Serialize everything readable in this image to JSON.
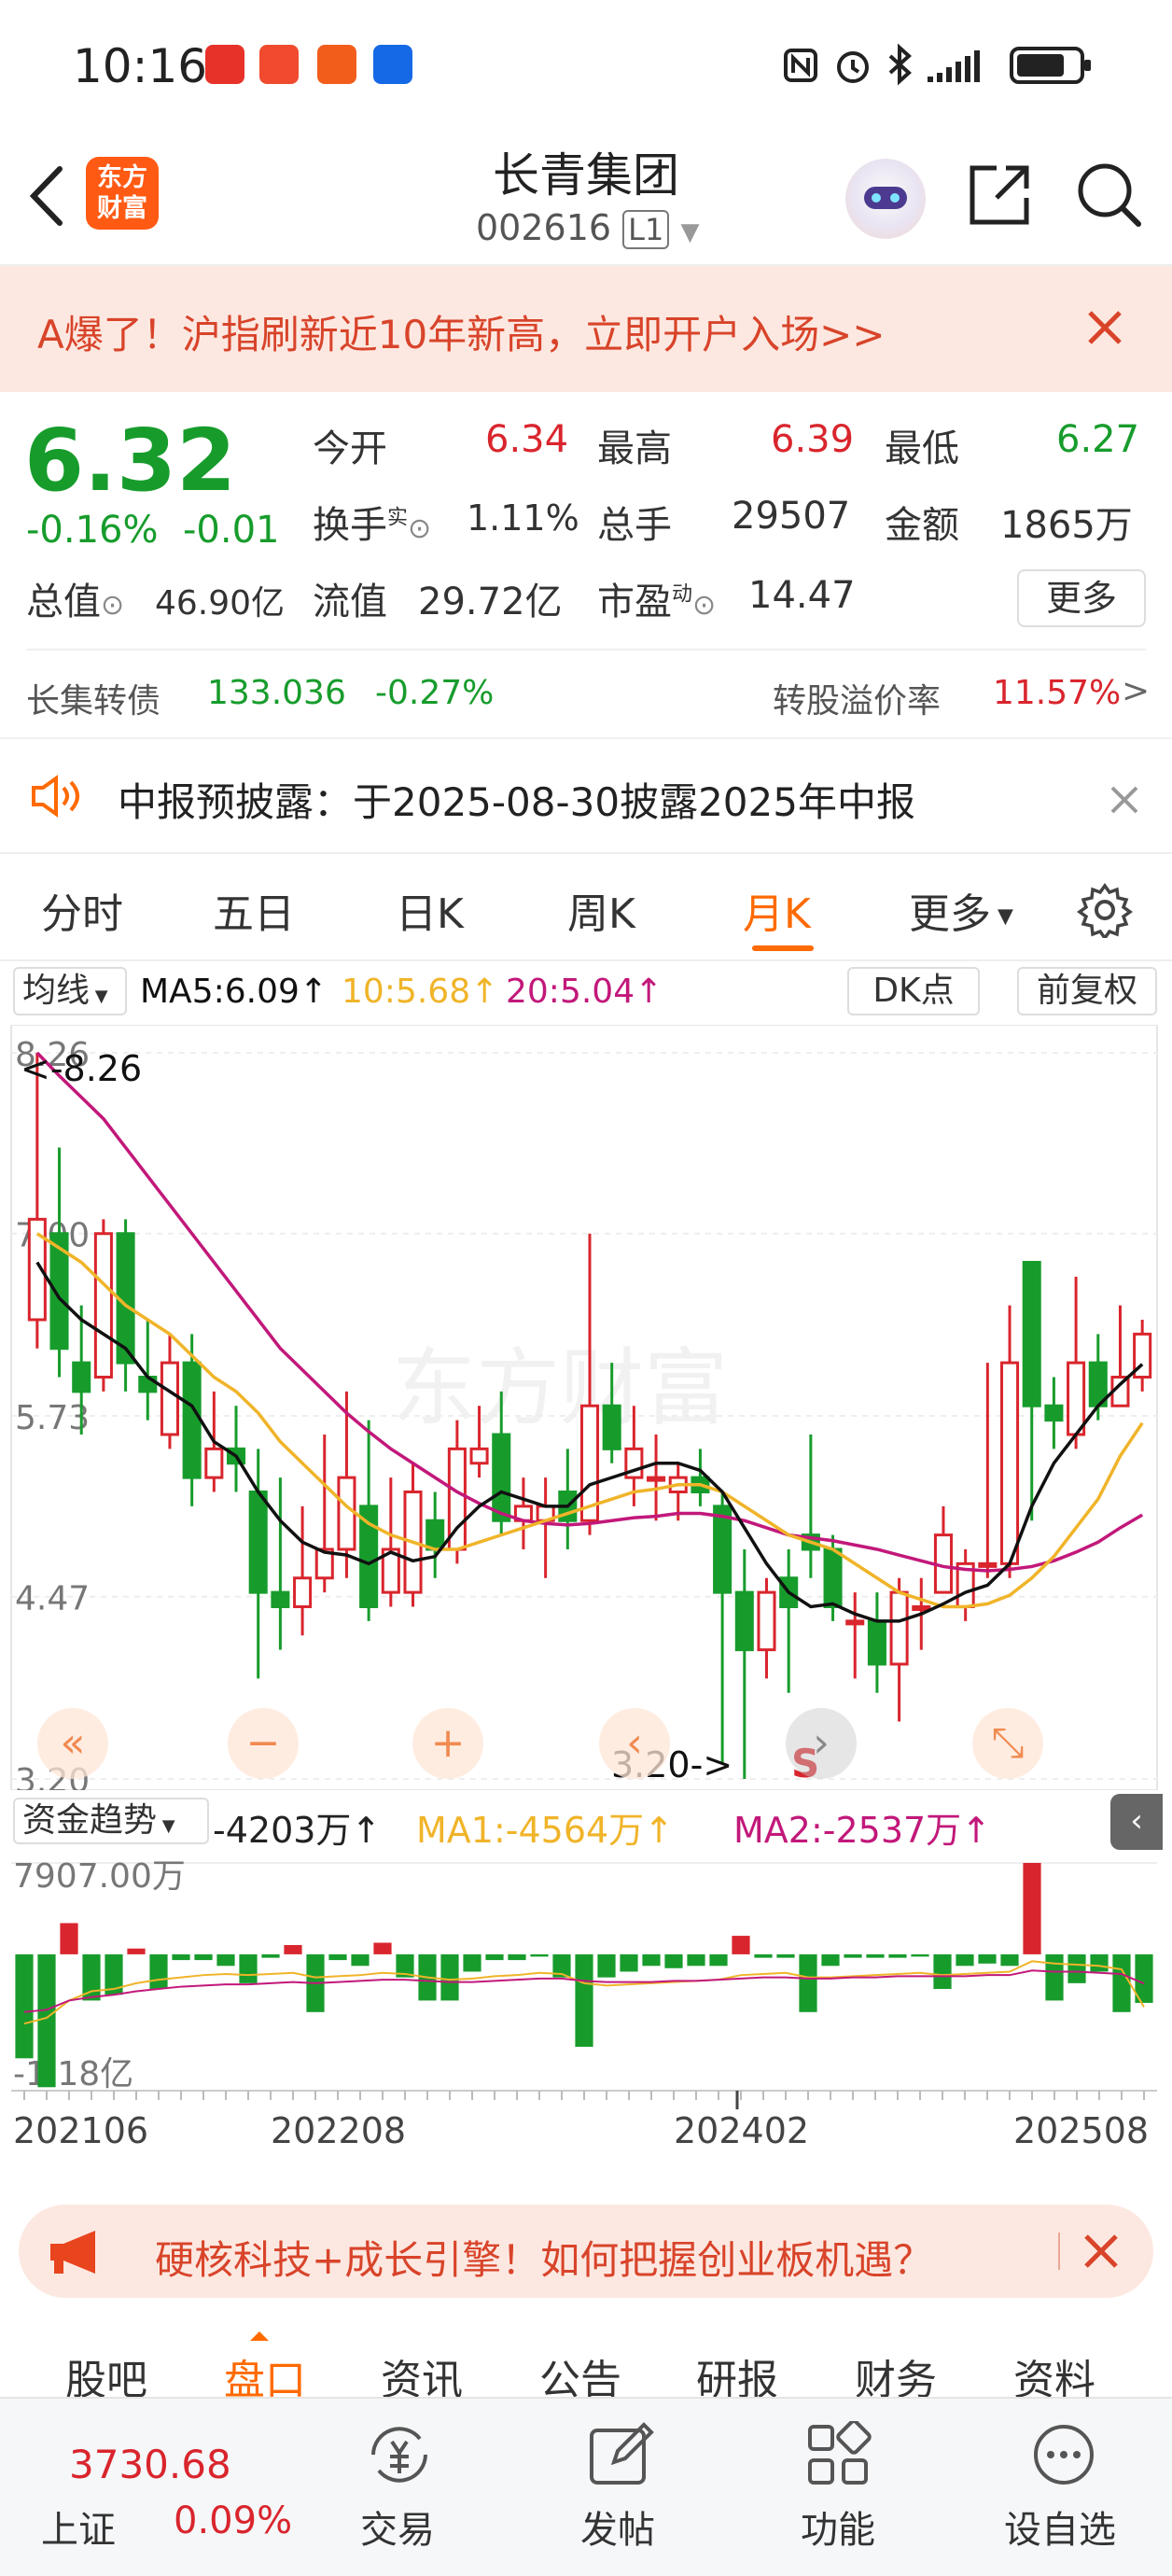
{
  "status_bar": {
    "time": "10:16"
  },
  "header": {
    "logo_text_1": "东方",
    "logo_text_2": "财富",
    "stock_name": "长青集团",
    "stock_code": "002616",
    "level": "L1"
  },
  "banner": {
    "text": "A爆了！沪指刷新近10年新高，立即开户入场>>"
  },
  "quote": {
    "price": "6.32",
    "change_pct": "-0.16%",
    "change": "-0.01",
    "open_label": "今开",
    "open": "6.34",
    "high_label": "最高",
    "high": "6.39",
    "low_label": "最低",
    "low": "6.27",
    "turnover_label": "换手",
    "turnover_sup": "实",
    "turnover": "1.11%",
    "volume_label": "总手",
    "volume": "29507",
    "amount_label": "金额",
    "amount": "1865万",
    "mktcap_label": "总值",
    "mktcap": "46.90亿",
    "float_label": "流值",
    "float": "29.72亿",
    "pe_label": "市盈",
    "pe_sup": "动",
    "pe": "14.47",
    "more_button": "更多",
    "bond_name": "长集转债",
    "bond_price": "133.036",
    "bond_change": "-0.27%",
    "premium_label": "转股溢价率",
    "premium": "11.57%",
    "premium_arrow": ">"
  },
  "notice": {
    "text": "中报预披露：于2025-08-30披露2025年中报"
  },
  "tabs": [
    "分时",
    "五日",
    "日K",
    "周K",
    "月K",
    "更多"
  ],
  "active_tab": "月K",
  "chart_toolbar": {
    "ma_select": "均线",
    "ma5": "MA5:6.09↑",
    "ma10": "10:5.68↑",
    "ma20": "20:5.04↑",
    "dk_button": "DK点",
    "adjust_button": "前复权"
  },
  "colors": {
    "up": "#d9252d",
    "down": "#179c2c",
    "ma5": "#111111",
    "ma10": "#f0b429",
    "ma20": "#c2187a",
    "accent": "#ff6a00"
  },
  "chart_data": [
    {
      "type": "candlestick",
      "title": "",
      "y_ticks": [
        "8.26",
        "7.00",
        "5.73",
        "4.47",
        "3.20"
      ],
      "ylim": [
        3.2,
        8.26
      ],
      "x_ticks": [
        "202106",
        "202208",
        "202402",
        "202508"
      ],
      "annotations": [
        "<-8.26",
        "3.20->",
        "S"
      ],
      "series": [
        {
          "name": "MA5",
          "value": "6.09"
        },
        {
          "name": "10",
          "value": "5.68"
        },
        {
          "name": "20",
          "value": "5.04"
        }
      ],
      "candles": [
        {
          "o": 6.4,
          "c": 7.1,
          "h": 8.26,
          "l": 6.2
        },
        {
          "o": 7.0,
          "c": 6.2,
          "h": 7.6,
          "l": 6.0
        },
        {
          "o": 6.1,
          "c": 5.9,
          "h": 6.5,
          "l": 5.6
        },
        {
          "o": 6.0,
          "c": 7.0,
          "h": 7.1,
          "l": 5.9
        },
        {
          "o": 7.0,
          "c": 6.1,
          "h": 7.1,
          "l": 5.9
        },
        {
          "o": 6.0,
          "c": 5.9,
          "h": 6.4,
          "l": 5.7
        },
        {
          "o": 5.6,
          "c": 6.1,
          "h": 6.3,
          "l": 5.5
        },
        {
          "o": 6.1,
          "c": 5.3,
          "h": 6.3,
          "l": 5.1
        },
        {
          "o": 5.3,
          "c": 5.5,
          "h": 5.9,
          "l": 5.2
        },
        {
          "o": 5.5,
          "c": 5.4,
          "h": 5.8,
          "l": 5.2
        },
        {
          "o": 5.2,
          "c": 4.5,
          "h": 5.5,
          "l": 3.9
        },
        {
          "o": 4.5,
          "c": 4.4,
          "h": 5.3,
          "l": 4.1
        },
        {
          "o": 4.4,
          "c": 4.6,
          "h": 5.1,
          "l": 4.2
        },
        {
          "o": 4.6,
          "c": 4.8,
          "h": 5.6,
          "l": 4.5
        },
        {
          "o": 4.8,
          "c": 5.3,
          "h": 5.9,
          "l": 4.6
        },
        {
          "o": 5.1,
          "c": 4.4,
          "h": 5.7,
          "l": 4.3
        },
        {
          "o": 4.5,
          "c": 4.8,
          "h": 5.3,
          "l": 4.4
        },
        {
          "o": 4.5,
          "c": 5.2,
          "h": 5.4,
          "l": 4.4
        },
        {
          "o": 5.0,
          "c": 4.8,
          "h": 5.2,
          "l": 4.6
        },
        {
          "o": 4.8,
          "c": 5.5,
          "h": 5.7,
          "l": 4.7
        },
        {
          "o": 5.4,
          "c": 5.5,
          "h": 5.8,
          "l": 5.3
        },
        {
          "o": 5.6,
          "c": 5.0,
          "h": 5.9,
          "l": 4.9
        },
        {
          "o": 5.0,
          "c": 5.1,
          "h": 5.3,
          "l": 4.8
        },
        {
          "o": 5.0,
          "c": 5.1,
          "h": 5.3,
          "l": 4.6
        },
        {
          "o": 5.2,
          "c": 5.0,
          "h": 5.5,
          "l": 4.8
        },
        {
          "o": 5.0,
          "c": 5.8,
          "h": 7.0,
          "l": 4.9
        },
        {
          "o": 5.8,
          "c": 5.5,
          "h": 6.1,
          "l": 5.4
        },
        {
          "o": 5.3,
          "c": 5.5,
          "h": 5.8,
          "l": 5.1
        },
        {
          "o": 5.3,
          "c": 5.3,
          "h": 5.6,
          "l": 5.0
        },
        {
          "o": 5.2,
          "c": 5.3,
          "h": 5.4,
          "l": 5.0
        },
        {
          "o": 5.3,
          "c": 5.2,
          "h": 5.5,
          "l": 5.1
        },
        {
          "o": 5.1,
          "c": 4.5,
          "h": 5.2,
          "l": 3.3
        },
        {
          "o": 4.5,
          "c": 4.1,
          "h": 4.8,
          "l": 3.2
        },
        {
          "o": 4.1,
          "c": 4.5,
          "h": 4.6,
          "l": 3.9
        },
        {
          "o": 4.6,
          "c": 4.4,
          "h": 4.8,
          "l": 3.8
        },
        {
          "o": 4.9,
          "c": 4.8,
          "h": 5.6,
          "l": 4.6
        },
        {
          "o": 4.8,
          "c": 4.4,
          "h": 4.9,
          "l": 4.3
        },
        {
          "o": 4.3,
          "c": 4.3,
          "h": 4.5,
          "l": 3.9
        },
        {
          "o": 4.3,
          "c": 4.0,
          "h": 4.5,
          "l": 3.8
        },
        {
          "o": 4.0,
          "c": 4.5,
          "h": 4.6,
          "l": 3.6
        },
        {
          "o": 4.4,
          "c": 4.4,
          "h": 4.6,
          "l": 4.1
        },
        {
          "o": 4.5,
          "c": 4.9,
          "h": 5.1,
          "l": 4.5
        },
        {
          "o": 4.4,
          "c": 4.7,
          "h": 4.8,
          "l": 4.3
        },
        {
          "o": 4.7,
          "c": 4.7,
          "h": 6.1,
          "l": 4.6
        },
        {
          "o": 4.7,
          "c": 6.1,
          "h": 6.5,
          "l": 4.6
        },
        {
          "o": 6.8,
          "c": 5.8,
          "h": 6.8,
          "l": 5.0
        },
        {
          "o": 5.8,
          "c": 5.7,
          "h": 6.0,
          "l": 5.5
        },
        {
          "o": 5.6,
          "c": 6.1,
          "h": 6.7,
          "l": 5.5
        },
        {
          "o": 6.1,
          "c": 5.8,
          "h": 6.3,
          "l": 5.7
        },
        {
          "o": 5.8,
          "c": 6.0,
          "h": 6.5,
          "l": 5.8
        },
        {
          "o": 6.0,
          "c": 6.3,
          "h": 6.4,
          "l": 5.9
        }
      ],
      "ma5": [
        6.8,
        6.55,
        6.4,
        6.3,
        6.2,
        6.0,
        5.9,
        5.8,
        5.55,
        5.45,
        5.2,
        5.0,
        4.85,
        4.78,
        4.76,
        4.7,
        4.78,
        4.72,
        4.75,
        4.95,
        5.1,
        5.2,
        5.15,
        5.1,
        5.1,
        5.25,
        5.3,
        5.35,
        5.4,
        5.4,
        5.35,
        5.2,
        4.95,
        4.7,
        4.5,
        4.4,
        4.42,
        4.35,
        4.3,
        4.3,
        4.35,
        4.42,
        4.5,
        4.55,
        4.7,
        5.1,
        5.4,
        5.6,
        5.8,
        5.95,
        6.09
      ],
      "ma10": [
        7.0,
        6.9,
        6.8,
        6.65,
        6.5,
        6.4,
        6.3,
        6.15,
        6.0,
        5.9,
        5.75,
        5.55,
        5.4,
        5.25,
        5.1,
        4.98,
        4.9,
        4.85,
        4.8,
        4.8,
        4.85,
        4.9,
        4.95,
        5.0,
        5.05,
        5.1,
        5.15,
        5.2,
        5.22,
        5.25,
        5.25,
        5.2,
        5.1,
        5.0,
        4.9,
        4.85,
        4.8,
        4.7,
        4.6,
        4.5,
        4.45,
        4.4,
        4.4,
        4.42,
        4.48,
        4.6,
        4.75,
        4.95,
        5.15,
        5.45,
        5.68
      ],
      "ma20": [
        8.26,
        8.1,
        7.95,
        7.8,
        7.6,
        7.4,
        7.2,
        7.0,
        6.8,
        6.6,
        6.4,
        6.2,
        6.05,
        5.9,
        5.75,
        5.62,
        5.5,
        5.4,
        5.3,
        5.2,
        5.12,
        5.05,
        5.0,
        4.98,
        4.97,
        4.98,
        5.0,
        5.02,
        5.03,
        5.05,
        5.05,
        5.03,
        5.0,
        4.95,
        4.9,
        4.88,
        4.86,
        4.83,
        4.8,
        4.76,
        4.72,
        4.68,
        4.66,
        4.65,
        4.66,
        4.68,
        4.72,
        4.78,
        4.85,
        4.95,
        5.04
      ]
    },
    {
      "type": "bar",
      "title": "资金趋势",
      "y_ticks": [
        "7907.00万",
        "-1.18亿"
      ],
      "series": [
        {
          "name": "资金趋势",
          "value": "-4203万↑"
        },
        {
          "name": "MA1",
          "value": "-4564万↑"
        },
        {
          "name": "MA2",
          "value": "-2537万↑"
        }
      ],
      "values": [
        -9000,
        -11500,
        2700,
        -4000,
        -3500,
        500,
        -3000,
        -500,
        -500,
        -1000,
        -2500,
        -300,
        800,
        -5000,
        -500,
        -1000,
        1000,
        -2000,
        -4000,
        -4000,
        -1500,
        -500,
        -500,
        -200,
        -2000,
        -8000,
        -2000,
        -1500,
        -1000,
        -1200,
        -1000,
        -1000,
        1600,
        -300,
        -300,
        -5000,
        -1000,
        -300,
        -300,
        -300,
        -200,
        -3000,
        -1000,
        -800,
        -1000,
        7907,
        -4000,
        -2500,
        -1500,
        -5000,
        -4203
      ],
      "ma1": [
        -6000,
        -5500,
        -4000,
        -3200,
        -3000,
        -2500,
        -2200,
        -2000,
        -1800,
        -1700,
        -1800,
        -1700,
        -1600,
        -2000,
        -1900,
        -1800,
        -1600,
        -1700,
        -2000,
        -2200,
        -2100,
        -1900,
        -1800,
        -1600,
        -1700,
        -2500,
        -2700,
        -2600,
        -2500,
        -2400,
        -2300,
        -2200,
        -1800,
        -1700,
        -1600,
        -2000,
        -2000,
        -1900,
        -1800,
        -1700,
        -1600,
        -1800,
        -1700,
        -1600,
        -1500,
        -600,
        -800,
        -900,
        -1000,
        -1300,
        -4564
      ],
      "ma2": [
        -5000,
        -4800,
        -4000,
        -3700,
        -3500,
        -3200,
        -3000,
        -2800,
        -2700,
        -2600,
        -2600,
        -2500,
        -2400,
        -2500,
        -2400,
        -2300,
        -2200,
        -2200,
        -2300,
        -2400,
        -2400,
        -2300,
        -2200,
        -2100,
        -2100,
        -2300,
        -2400,
        -2400,
        -2400,
        -2300,
        -2300,
        -2200,
        -2100,
        -2000,
        -2000,
        -2100,
        -2100,
        -2000,
        -2000,
        -1900,
        -1900,
        -1900,
        -1900,
        -1800,
        -1800,
        -1400,
        -1500,
        -1500,
        -1600,
        -1700,
        -2537
      ]
    }
  ],
  "fund_toolbar": {
    "select": "资金趋势",
    "value": "-4203万↑",
    "ma1": "MA1:-4564万↑",
    "ma2": "MA2:-2537万↑"
  },
  "promo": {
    "text": "硬核科技+成长引擎！如何把握创业板机遇？"
  },
  "sub_tabs": [
    "股吧",
    "盘口",
    "资讯",
    "公告",
    "研报",
    "财务",
    "资料"
  ],
  "active_sub_tab": "盘口",
  "bottom_nav": {
    "index_value": "3730.68",
    "index_name": "上证",
    "index_change": "0.09%",
    "trade": "交易",
    "post": "发帖",
    "function": "功能",
    "watchlist": "设自选"
  }
}
